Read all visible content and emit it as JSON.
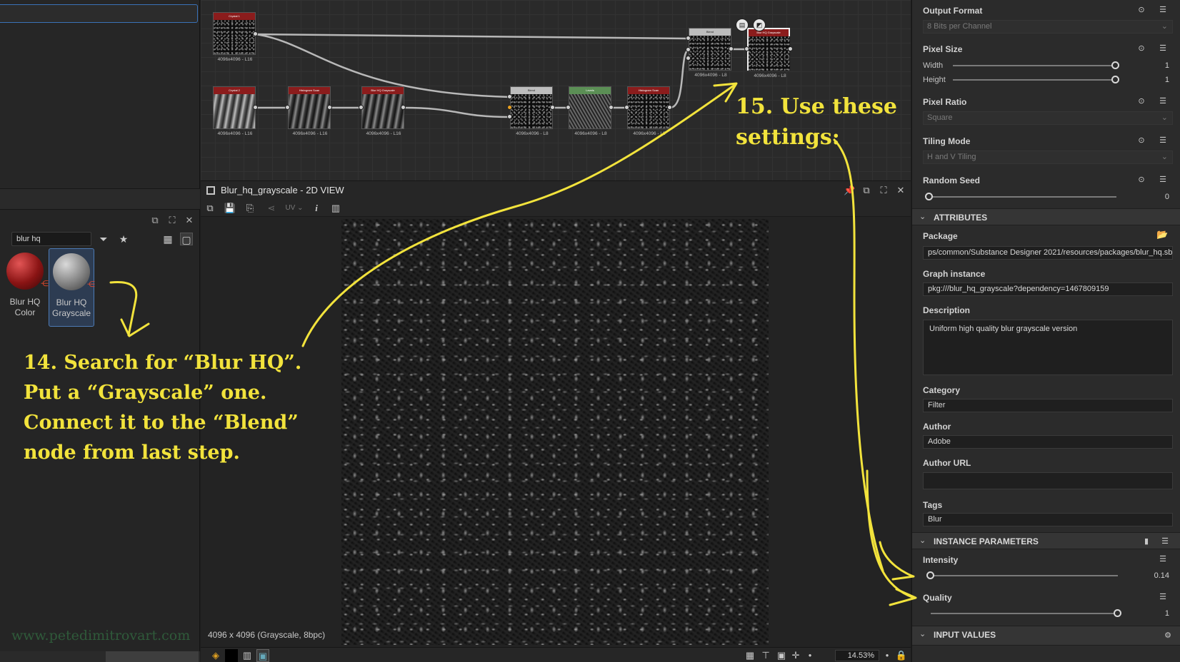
{
  "library": {
    "search_value": "blur hq",
    "items": [
      {
        "label_line1": "Blur HQ",
        "label_line2": "Color"
      },
      {
        "label_line1": "Blur HQ",
        "label_line2": "Grayscale"
      }
    ]
  },
  "graph": {
    "nodes": [
      {
        "title": "Crystal 1",
        "res": "4096x4096 - L16"
      },
      {
        "title": "Crystal 2",
        "res": "4096x4096 - L16"
      },
      {
        "title": "Histogram Scan",
        "res": "4096x4096 - L16"
      },
      {
        "title": "Blur HQ Grayscale",
        "res": "4096x4096 - L16"
      },
      {
        "title": "Blend",
        "res": "4096x4096 - L8"
      },
      {
        "title": "Levels",
        "res": "4096x4096 - L8"
      },
      {
        "title": "Histogram Scan",
        "res": "4096x4096 - L8"
      },
      {
        "title": "Blend",
        "res": "4096x4096 - L8"
      },
      {
        "title": "Blur HQ Grayscale",
        "res": "4096x4096 - L8"
      }
    ]
  },
  "view2d": {
    "title": "Blur_hq_grayscale - 2D VIEW",
    "uv_label": "UV",
    "status": "4096 x 4096 (Grayscale, 8bpc)",
    "zoom": "14.53%"
  },
  "props": {
    "output_format": {
      "label": "Output Format",
      "value": "8 Bits per Channel"
    },
    "pixel_size": {
      "label": "Pixel Size",
      "width_label": "Width",
      "width_value": "1",
      "height_label": "Height",
      "height_value": "1",
      "width_level": 1.0,
      "height_level": 1.0
    },
    "pixel_ratio": {
      "label": "Pixel Ratio",
      "value": "Square"
    },
    "tiling_mode": {
      "label": "Tiling Mode",
      "value": "H and V Tiling"
    },
    "random_seed": {
      "label": "Random Seed",
      "value": "0",
      "level": 0.0
    },
    "attributes_section": "ATTRIBUTES",
    "package": {
      "label": "Package",
      "value": "ps/common/Substance Designer 2021/resources/packages/blur_hq.sbs"
    },
    "graph_instance": {
      "label": "Graph instance",
      "value": "pkg:///blur_hq_grayscale?dependency=1467809159"
    },
    "description": {
      "label": "Description",
      "value": "Uniform high quality blur grayscale version"
    },
    "category": {
      "label": "Category",
      "value": "Filter"
    },
    "author": {
      "label": "Author",
      "value": "Adobe"
    },
    "author_url": {
      "label": "Author URL",
      "value": ""
    },
    "tags": {
      "label": "Tags",
      "value": "Blur"
    },
    "instance_section": "INSTANCE PARAMETERS",
    "intensity": {
      "label": "Intensity",
      "value": "0.14",
      "level": 0.0
    },
    "quality": {
      "label": "Quality",
      "value": "1",
      "level": 1.0
    },
    "input_section": "INPUT VALUES"
  },
  "annotations": {
    "step14": [
      "14. Search for “Blur HQ”.",
      "Put a “Grayscale” one.",
      "Connect it to the “Blend”",
      "node from last step."
    ],
    "step15": [
      "15. Use these",
      "settings:"
    ],
    "watermark": "www.petedimitrovart.com",
    "color": "#f2e33c"
  }
}
